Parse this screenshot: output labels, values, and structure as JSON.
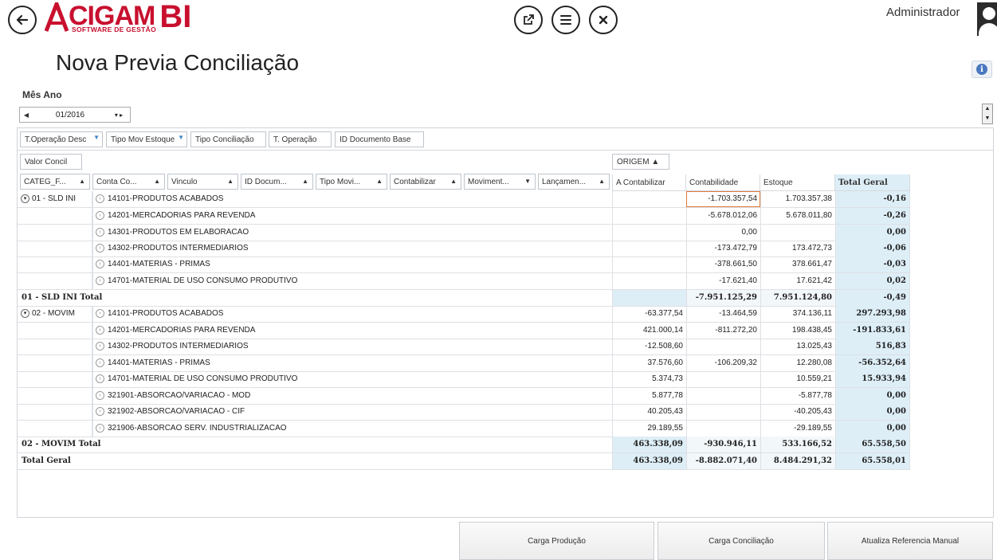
{
  "app": {
    "logo_word": "CIGAM",
    "logo_bi": "BI",
    "logo_sub": "SOFTWARE DE GESTÃO",
    "user": "Administrador"
  },
  "header_icons": {
    "back": "back-arrow-icon",
    "open_external": "external-link-icon",
    "menu": "menu-icon",
    "close": "close-icon"
  },
  "page_title": "Nova Previa Conciliação",
  "filter": {
    "label": "Mês Ano",
    "value": "01/2016"
  },
  "filter_fields": [
    "T.Operação Desc",
    "Tipo Mov Estoque",
    "Tipo Conciliação",
    "T. Operação",
    "ID Documento Base"
  ],
  "data_field": "Valor Concil",
  "column_field": "ORIGEM",
  "row_fields": [
    "CATEG_F...",
    "Conta Co...",
    "Vinculo",
    "ID Docum...",
    "Tipo Movi...",
    "Contabilizar",
    "Moviment...",
    "Lançamen..."
  ],
  "data_columns": [
    "A Contabilizar",
    "Contabilidade",
    "Estoque",
    "Total Geral"
  ],
  "groups": [
    {
      "name": "01 - SLD INI",
      "rows": [
        {
          "account": "14101-PRODUTOS ACABADOS",
          "a_contabilizar": "",
          "contabilidade": "-1.703.357,54",
          "estoque": "1.703.357,38",
          "total": "-0,16"
        },
        {
          "account": "14201-MERCADORIAS PARA REVENDA",
          "a_contabilizar": "",
          "contabilidade": "-5.678.012,06",
          "estoque": "5.678.011,80",
          "total": "-0,26"
        },
        {
          "account": "14301-PRODUTOS EM ELABORACAO",
          "a_contabilizar": "",
          "contabilidade": "0,00",
          "estoque": "",
          "total": "0,00"
        },
        {
          "account": "14302-PRODUTOS INTERMEDIARIOS",
          "a_contabilizar": "",
          "contabilidade": "-173.472,79",
          "estoque": "173.472,73",
          "total": "-0,06"
        },
        {
          "account": "14401-MATERIAS - PRIMAS",
          "a_contabilizar": "",
          "contabilidade": "-378.661,50",
          "estoque": "378.661,47",
          "total": "-0,03"
        },
        {
          "account": "14701-MATERIAL DE USO CONSUMO PRODUTIVO",
          "a_contabilizar": "",
          "contabilidade": "-17.621,40",
          "estoque": "17.621,42",
          "total": "0,02"
        }
      ],
      "total": {
        "label": "01 - SLD INI Total",
        "a_contabilizar": "",
        "contabilidade": "-7.951.125,29",
        "estoque": "7.951.124,80",
        "total": "-0,49"
      }
    },
    {
      "name": "02 - MOVIM",
      "rows": [
        {
          "account": "14101-PRODUTOS ACABADOS",
          "a_contabilizar": "-63.377,54",
          "contabilidade": "-13.464,59",
          "estoque": "374.136,11",
          "total": "297.293,98"
        },
        {
          "account": "14201-MERCADORIAS PARA REVENDA",
          "a_contabilizar": "421.000,14",
          "contabilidade": "-811.272,20",
          "estoque": "198.438,45",
          "total": "-191.833,61"
        },
        {
          "account": "14302-PRODUTOS INTERMEDIARIOS",
          "a_contabilizar": "-12.508,60",
          "contabilidade": "",
          "estoque": "13.025,43",
          "total": "516,83"
        },
        {
          "account": "14401-MATERIAS - PRIMAS",
          "a_contabilizar": "37.576,60",
          "contabilidade": "-106.209,32",
          "estoque": "12.280,08",
          "total": "-56.352,64"
        },
        {
          "account": "14701-MATERIAL DE USO CONSUMO PRODUTIVO",
          "a_contabilizar": "5.374,73",
          "contabilidade": "",
          "estoque": "10.559,21",
          "total": "15.933,94"
        },
        {
          "account": "321901-ABSORCAO/VARIACAO - MOD",
          "a_contabilizar": "5.877,78",
          "contabilidade": "",
          "estoque": "-5.877,78",
          "total": "0,00"
        },
        {
          "account": "321902-ABSORCAO/VARIACAO - CIF",
          "a_contabilizar": "40.205,43",
          "contabilidade": "",
          "estoque": "-40.205,43",
          "total": "0,00"
        },
        {
          "account": "321906-ABSORCAO SERV. INDUSTRIALIZACAO",
          "a_contabilizar": "29.189,55",
          "contabilidade": "",
          "estoque": "-29.189,55",
          "total": "0,00"
        }
      ],
      "total": {
        "label": "02 - MOVIM Total",
        "a_contabilizar": "463.338,09",
        "contabilidade": "-930.946,11",
        "estoque": "533.166,52",
        "total": "65.558,50"
      }
    }
  ],
  "grand_total": {
    "label": "Total Geral",
    "a_contabilizar": "463.338,09",
    "contabilidade": "-8.882.071,40",
    "estoque": "8.484.291,32",
    "total": "65.558,01"
  },
  "buttons": {
    "carga_producao": "Carga Produção",
    "carga_conciliacao": "Carga Conciliação",
    "atualiza": "Atualiza Referencia Manual"
  },
  "colors": {
    "brand": "#c8102e",
    "total_bg": "#ddeef7",
    "selected_border": "#e07a3a"
  }
}
